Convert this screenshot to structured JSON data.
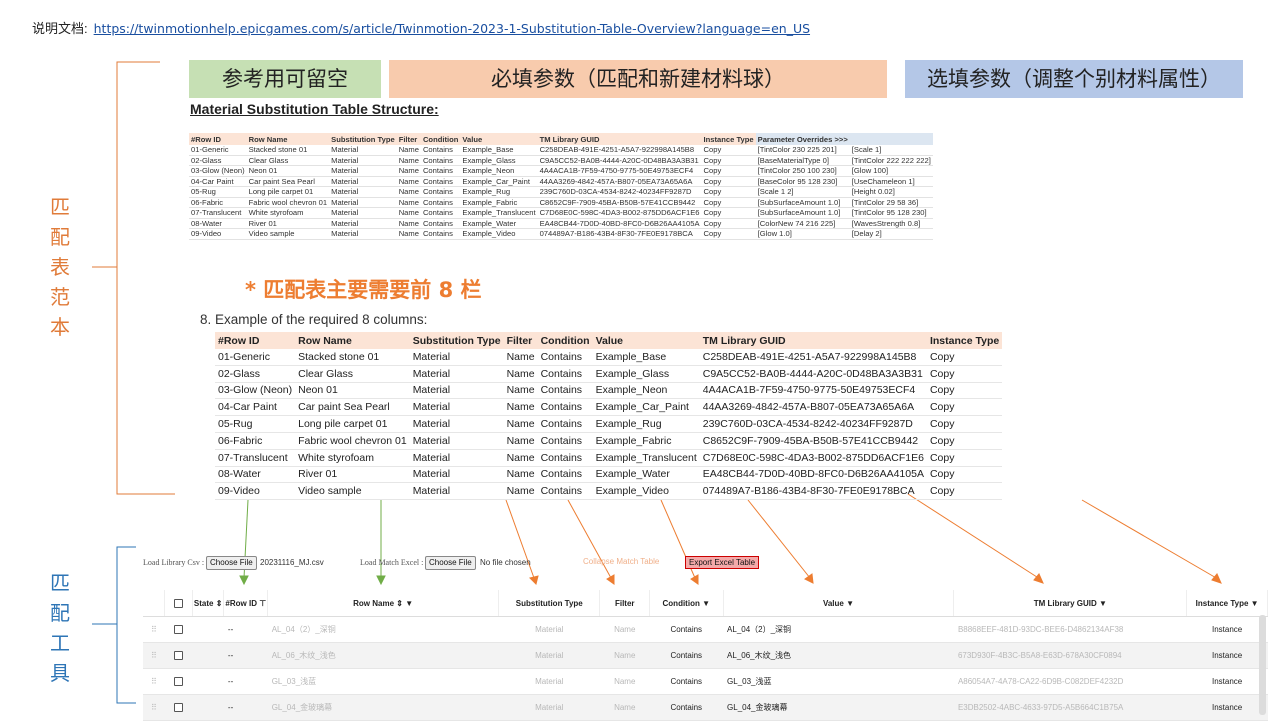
{
  "doc": {
    "label": "说明文档:",
    "url": "https://twinmotionhelp.epicgames.com/s/article/Twinmotion-2023-1-Substitution-Table-Overview?language=en_US"
  },
  "headers": {
    "optional": "参考用可留空",
    "required": "必填参数（匹配和新建材料球）",
    "select": "选填参数（调整个别材料属性）"
  },
  "side_labels": {
    "table_example": "匹配表范本",
    "tool": "匹配工具"
  },
  "structure_title": "Material Substitution Table Structure:",
  "small_table": {
    "columns": [
      "#Row ID",
      "Row Name",
      "Substitution Type",
      "Filter",
      "Condition",
      "Value",
      "TM Library GUID",
      "Instance Type",
      "Parameter Overrides >>>",
      ""
    ],
    "rows": [
      [
        "01-Generic",
        "Stacked stone 01",
        "Material",
        "Name",
        "Contains",
        "Example_Base",
        "C258DEAB-491E-4251-A5A7-922998A145B8",
        "Copy",
        "[TintColor 230 225 201]",
        "[Scale 1]"
      ],
      [
        "02-Glass",
        "Clear Glass",
        "Material",
        "Name",
        "Contains",
        "Example_Glass",
        "C9A5CC52-BA0B-4444-A20C-0D48BA3A3B31",
        "Copy",
        "[BaseMaterialType 0]",
        "[TintColor 222 222 222]"
      ],
      [
        "03-Glow (Neon)",
        "Neon 01",
        "Material",
        "Name",
        "Contains",
        "Example_Neon",
        "4A4ACA1B-7F59-4750-9775-50E49753ECF4",
        "Copy",
        "[TintColor 250 100 230]",
        "[Glow 100]"
      ],
      [
        "04-Car Paint",
        "Car paint Sea Pearl",
        "Material",
        "Name",
        "Contains",
        "Example_Car_Paint",
        "44AA3269-4842-457A-B807-05EA73A65A6A",
        "Copy",
        "[BaseColor 95 128 230]",
        "[UseChameleon 1]"
      ],
      [
        "05-Rug",
        "Long pile carpet 01",
        "Material",
        "Name",
        "Contains",
        "Example_Rug",
        "239C760D-03CA-4534-8242-40234FF9287D",
        "Copy",
        "[Scale 1 2]",
        "[Height 0.02]"
      ],
      [
        "06-Fabric",
        "Fabric wool chevron 01",
        "Material",
        "Name",
        "Contains",
        "Example_Fabric",
        "C8652C9F-7909-45BA-B50B-57E41CCB9442",
        "Copy",
        "[SubSurfaceAmount 1.0]",
        "[TintColor 29 58 36]"
      ],
      [
        "07-Translucent",
        "White styrofoam",
        "Material",
        "Name",
        "Contains",
        "Example_Translucent",
        "C7D68E0C-598C-4DA3-B002-875DD6ACF1E6",
        "Copy",
        "[SubSurfaceAmount 1.0]",
        "[TintColor 95 128 230]"
      ],
      [
        "08-Water",
        "River 01",
        "Material",
        "Name",
        "Contains",
        "Example_Water",
        "EA48CB44-7D0D-40BD-8FC0-D6B26AA4105A",
        "Copy",
        "[ColorNew 74 216 225]",
        "[WavesStrength 0.8]"
      ],
      [
        "09-Video",
        "Video sample",
        "Material",
        "Name",
        "Contains",
        "Example_Video",
        "074489A7-B186-43B4-8F30-7FE0E9178BCA",
        "Copy",
        "[Glow 1.0]",
        "[Delay 2]"
      ]
    ]
  },
  "note": "* 匹配表主要需要前 8 栏",
  "example_title": "8. Example of the required 8 columns:",
  "example_table": {
    "columns": [
      "#Row ID",
      "Row Name",
      "Substitution Type",
      "Filter",
      "Condition",
      "Value",
      "TM Library GUID",
      "Instance Type"
    ],
    "rows": [
      [
        "01-Generic",
        "Stacked stone 01",
        "Material",
        "Name",
        "Contains",
        "Example_Base",
        "C258DEAB-491E-4251-A5A7-922998A145B8",
        "Copy"
      ],
      [
        "02-Glass",
        "Clear Glass",
        "Material",
        "Name",
        "Contains",
        "Example_Glass",
        "C9A5CC52-BA0B-4444-A20C-0D48BA3A3B31",
        "Copy"
      ],
      [
        "03-Glow (Neon)",
        "Neon 01",
        "Material",
        "Name",
        "Contains",
        "Example_Neon",
        "4A4ACA1B-7F59-4750-9775-50E49753ECF4",
        "Copy"
      ],
      [
        "04-Car Paint",
        "Car paint Sea Pearl",
        "Material",
        "Name",
        "Contains",
        "Example_Car_Paint",
        "44AA3269-4842-457A-B807-05EA73A65A6A",
        "Copy"
      ],
      [
        "05-Rug",
        "Long pile carpet 01",
        "Material",
        "Name",
        "Contains",
        "Example_Rug",
        "239C760D-03CA-4534-8242-40234FF9287D",
        "Copy"
      ],
      [
        "06-Fabric",
        "Fabric wool chevron 01",
        "Material",
        "Name",
        "Contains",
        "Example_Fabric",
        "C8652C9F-7909-45BA-B50B-57E41CCB9442",
        "Copy"
      ],
      [
        "07-Translucent",
        "White styrofoam",
        "Material",
        "Name",
        "Contains",
        "Example_Translucent",
        "C7D68E0C-598C-4DA3-B002-875DD6ACF1E6",
        "Copy"
      ],
      [
        "08-Water",
        "River 01",
        "Material",
        "Name",
        "Contains",
        "Example_Water",
        "EA48CB44-7D0D-40BD-8FC0-D6B26AA4105A",
        "Copy"
      ],
      [
        "09-Video",
        "Video sample",
        "Material",
        "Name",
        "Contains",
        "Example_Video",
        "074489A7-B186-43B4-8F30-7FE0E9178BCA",
        "Copy"
      ]
    ]
  },
  "tool": {
    "load_library_label": "Load Library Csv :",
    "choose_file": "Choose File",
    "library_file": "20231116_MJ.csv",
    "load_match_label": "Load Match Excel :",
    "no_file": "No file chosen",
    "collapse_label": "Collapse Match Table",
    "export_label": "Export Excel Table",
    "columns": {
      "state": "State",
      "row_id": "#Row ID",
      "row_name": "Row Name",
      "sub_type": "Substitution Type",
      "filter": "Filter",
      "condition": "Condition",
      "value": "Value",
      "guid": "TM Library GUID",
      "instance": "Instance Type"
    },
    "rows": [
      {
        "row_id": "--",
        "row_name": "AL_04（2）_深铜",
        "sub_type": "Material",
        "filter": "Name",
        "condition": "Contains",
        "value": "AL_04（2）_深铜",
        "guid": "B8868EEF-481D-93DC-BEE6-D4862134AF38",
        "instance": "Instance"
      },
      {
        "row_id": "--",
        "row_name": "AL_06_木纹_浅色",
        "sub_type": "Material",
        "filter": "Name",
        "condition": "Contains",
        "value": "AL_06_木纹_浅色",
        "guid": "673D930F-4B3C-B5A8-E63D-678A30CF0894",
        "instance": "Instance"
      },
      {
        "row_id": "--",
        "row_name": "GL_03_浅蓝",
        "sub_type": "Material",
        "filter": "Name",
        "condition": "Contains",
        "value": "GL_03_浅蓝",
        "guid": "A86054A7-4A78-CA22-6D9B-C082DEF4232D",
        "instance": "Instance"
      },
      {
        "row_id": "--",
        "row_name": "GL_04_金玻璃幕",
        "sub_type": "Material",
        "filter": "Name",
        "condition": "Contains",
        "value": "GL_04_金玻璃幕",
        "guid": "E3DB2502-4ABC-4633-97D5-A5B664C1B75A",
        "instance": "Instance"
      }
    ]
  },
  "colors": {
    "orange_accent": "#ed7d31",
    "blue_accent": "#2e75b6",
    "green_arrow": "#70ad47",
    "header_optional": "#c6e0b4",
    "header_required": "#f8cbad",
    "header_select": "#b4c7e7"
  }
}
